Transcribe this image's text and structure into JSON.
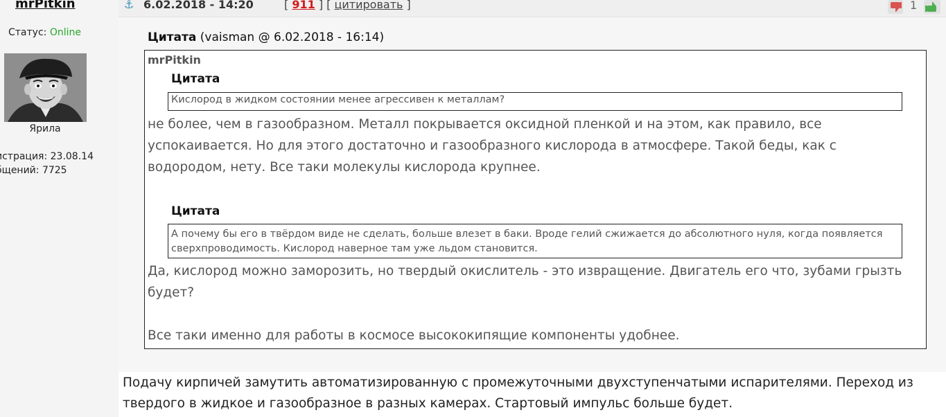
{
  "user": {
    "name": "mrPitkin",
    "status_label": "Статус:",
    "status_value": "Online",
    "rank": "Ярила",
    "registered": "истрация: 23.08.14",
    "messages": "бщений: 7725"
  },
  "header": {
    "anchor_icon": "anchor-icon",
    "date": "6.02.2018 - 14:20",
    "open_bracket": "[",
    "post_number": "911",
    "mid_bracket": "] [",
    "quote_link": "цитировать",
    "close_bracket": "]",
    "vote_count": "1"
  },
  "quote": {
    "title_label": "Цитата",
    "title_meta": "(vaisman @ 6.02.2018 - 16:14)",
    "author": "mrPitkin",
    "inner1_title": "Цитата",
    "inner1_text": "Кислород в жидком состоянии менее агрессивен к металлам?",
    "reply1": "не более, чем в газообразном. Металл покрывается оксидной пленкой и на этом, как правило, все успокаивается. Но для этого достаточно и газообразного кислорода в атмосфере. Такой беды, как с водородом, нету. Все таки молекулы кислорода крупнее.",
    "inner2_title": "Цитата",
    "inner2_text": "А почему бы его в твёрдом виде не сделать, больше влезет в баки. Вроде гелий сжижается до абсолютного нуля, когда появляется сверхпроводимость. Кислород наверное там уже льдом становится.",
    "reply2": "Да, кислород можно заморозить, но твердый окислитель - это извращение. Двигатель его что, зубами грызть будет?",
    "reply3": "Все таки именно для работы в космосе высококипящие компоненты удобнее."
  },
  "post_text": "Подачу кирпичей замутить автоматизированную с промежуточными двухступенчатыми испарителями. Переход из твердого в жидкое и газообразное в разных камерах. Стартовый импульс больше будет.",
  "colors": {
    "online": "#27a827",
    "post_number": "#d21a1a",
    "vote_down": "#d9534f",
    "vote_up": "#4caf50",
    "anchor": "#3a8fb7"
  }
}
